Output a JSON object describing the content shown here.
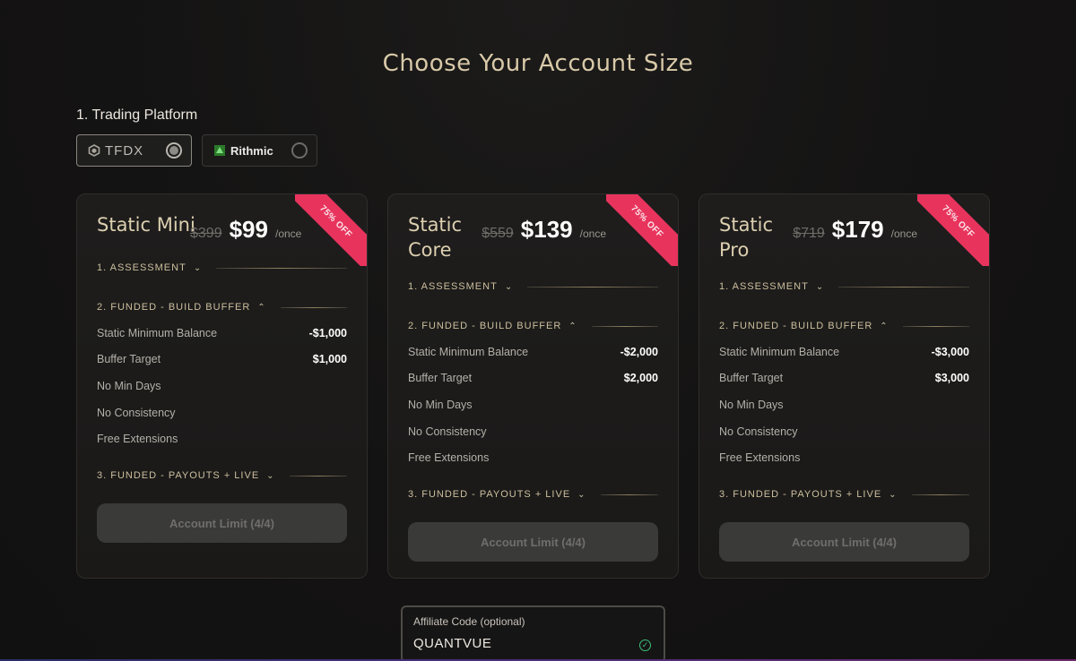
{
  "page": {
    "title": "Choose Your Account Size"
  },
  "platform": {
    "label": "1. Trading Platform",
    "options": [
      {
        "name": "TFDX",
        "selected": true
      },
      {
        "name": "Rithmic",
        "selected": false
      }
    ]
  },
  "plans": [
    {
      "name": "Static Mini",
      "old_price": "$399",
      "price": "$99",
      "per": "/once",
      "badge": "75% OFF",
      "sections": {
        "assessment": "1. ASSESSMENT",
        "build_buffer": "2. FUNDED - BUILD BUFFER",
        "payouts": "3. FUNDED - PAYOUTS + LIVE"
      },
      "rows": [
        {
          "label": "Static Minimum Balance",
          "value": "-$1,000"
        },
        {
          "label": "Buffer Target",
          "value": "$1,000"
        },
        {
          "label": "No Min Days",
          "value": ""
        },
        {
          "label": "No Consistency",
          "value": ""
        },
        {
          "label": "Free Extensions",
          "value": ""
        }
      ],
      "cta": "Account Limit (4/4)"
    },
    {
      "name": "Static Core",
      "old_price": "$559",
      "price": "$139",
      "per": "/once",
      "badge": "75% OFF",
      "sections": {
        "assessment": "1. ASSESSMENT",
        "build_buffer": "2. FUNDED - BUILD BUFFER",
        "payouts": "3. FUNDED - PAYOUTS + LIVE"
      },
      "rows": [
        {
          "label": "Static Minimum Balance",
          "value": "-$2,000"
        },
        {
          "label": "Buffer Target",
          "value": "$2,000"
        },
        {
          "label": "No Min Days",
          "value": ""
        },
        {
          "label": "No Consistency",
          "value": ""
        },
        {
          "label": "Free Extensions",
          "value": ""
        }
      ],
      "cta": "Account Limit (4/4)"
    },
    {
      "name": "Static Pro",
      "old_price": "$719",
      "price": "$179",
      "per": "/once",
      "badge": "75% OFF",
      "sections": {
        "assessment": "1. ASSESSMENT",
        "build_buffer": "2. FUNDED - BUILD BUFFER",
        "payouts": "3. FUNDED - PAYOUTS + LIVE"
      },
      "rows": [
        {
          "label": "Static Minimum Balance",
          "value": "-$3,000"
        },
        {
          "label": "Buffer Target",
          "value": "$3,000"
        },
        {
          "label": "No Min Days",
          "value": ""
        },
        {
          "label": "No Consistency",
          "value": ""
        },
        {
          "label": "Free Extensions",
          "value": ""
        }
      ],
      "cta": "Account Limit (4/4)"
    }
  ],
  "affiliate": {
    "label": "Affiliate Code (optional)",
    "value": "QUANTVUE",
    "valid_icon": "check-circle-icon"
  },
  "colors": {
    "accent_gold": "#d8c9a8",
    "badge_red": "#e8345d",
    "valid_green": "#3fbf7a"
  }
}
